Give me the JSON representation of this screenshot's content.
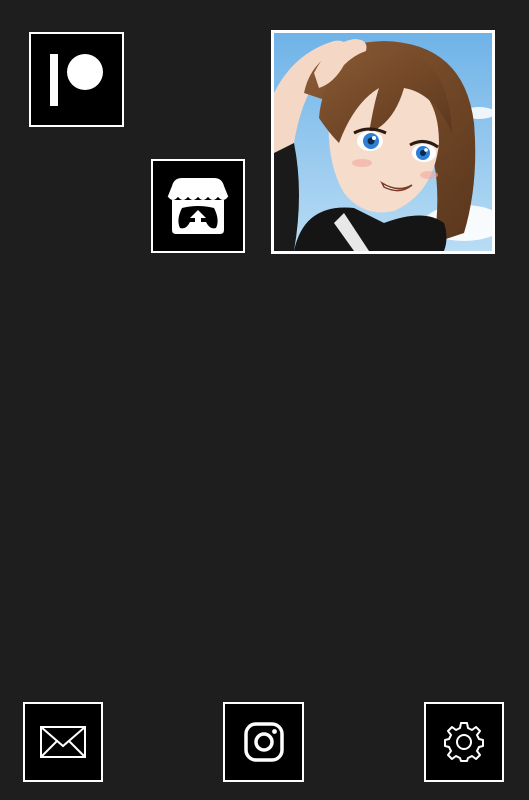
{
  "app": {
    "background": "#1e1e1e"
  },
  "tiles": [
    {
      "id": "patreon",
      "icon": "patreon-icon"
    },
    {
      "id": "itch",
      "icon": "itch-io-icon"
    },
    {
      "id": "avatar",
      "icon": "profile-avatar"
    }
  ],
  "dock": [
    {
      "id": "mail",
      "icon": "mail-icon"
    },
    {
      "id": "instagram",
      "icon": "instagram-icon"
    },
    {
      "id": "settings",
      "icon": "gear-icon"
    }
  ],
  "colors": {
    "tile_bg": "#000000",
    "tile_border": "#ffffff",
    "sky": "#8ec5ec",
    "hair": "#6b4226"
  }
}
